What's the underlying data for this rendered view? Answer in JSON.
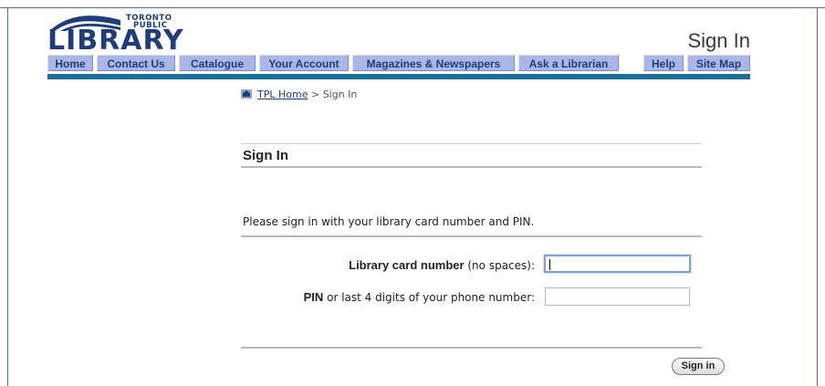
{
  "logo": {
    "small_line1": "TORONTO",
    "small_line2": "PUBLIC",
    "big": "LIBRARY"
  },
  "header": {
    "title": "Sign In"
  },
  "nav": {
    "items": [
      {
        "label": "Home"
      },
      {
        "label": "Contact Us"
      },
      {
        "label": "Catalogue"
      },
      {
        "label": "Your Account"
      },
      {
        "label": "Magazines & Newspapers"
      },
      {
        "label": "Ask a Librarian"
      },
      {
        "label": "Help"
      },
      {
        "label": "Site Map"
      }
    ]
  },
  "breadcrumb": {
    "home_link": "TPL Home",
    "separator": " > ",
    "current": "Sign In"
  },
  "main": {
    "title": "Sign In",
    "intro": "Please sign in with your library card number and PIN.",
    "card_label_bold": "Library card number",
    "card_label_rest": " (no spaces):",
    "card_value": "",
    "pin_label_bold": "PIN",
    "pin_label_rest": " or last 4 digits of your phone number:",
    "pin_value": "",
    "submit_label": "Sign in"
  },
  "colors": {
    "nav_bg": "#a9b6e6",
    "nav_text": "#1e3d7a",
    "nav_bar": "#1f6f95",
    "logo": "#1e3d7a"
  }
}
